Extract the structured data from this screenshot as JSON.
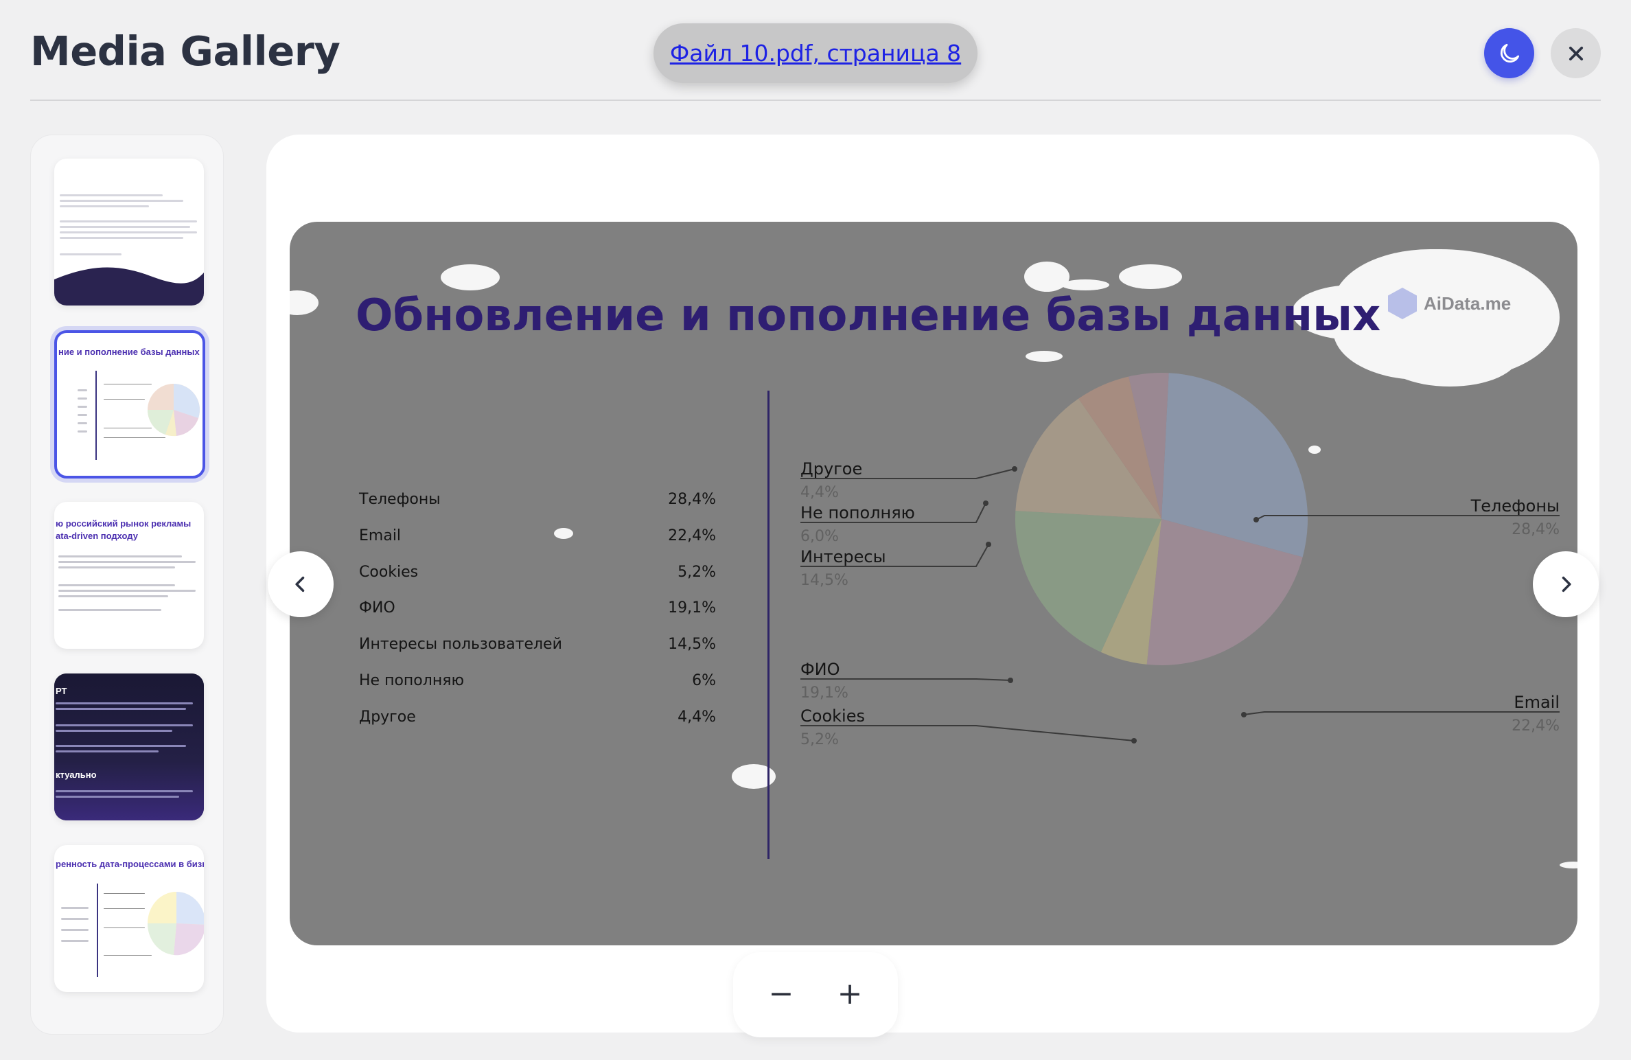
{
  "header": {
    "title": "Media Gallery",
    "source_link": "Файл 10.pdf, страница 8",
    "theme_icon": "moon-icon",
    "close_icon": "close-icon"
  },
  "thumbnails": [
    {
      "heading": "",
      "selected": false
    },
    {
      "heading": "ние и пополнение базы данных",
      "selected": true
    },
    {
      "heading": "ю российский рынок рекламы",
      "heading2": "ata-driven подходу",
      "selected": false
    },
    {
      "heading": "ктуально",
      "selected": false,
      "dark": true
    },
    {
      "heading": "ренность дата-процессами в бизнес",
      "selected": false
    }
  ],
  "slide": {
    "title": "Обновление и пополнение базы данных",
    "brand": "AiData.me",
    "stats": [
      {
        "label": "Телефоны",
        "value": "28,4%"
      },
      {
        "label": "Email",
        "value": "22,4%"
      },
      {
        "label": "Cookies",
        "value": "5,2%"
      },
      {
        "label": "ФИО",
        "value": "19,1%"
      },
      {
        "label": "Интересы пользователей",
        "value": "14,5%"
      },
      {
        "label": "Не пополняю",
        "value": "6%"
      },
      {
        "label": "Другое",
        "value": "4,4%"
      }
    ],
    "pie_labels": {
      "other": {
        "label": "Другое",
        "pct": "4,4%"
      },
      "no_update": {
        "label": "Не пополняю",
        "pct": "6,0%"
      },
      "interests": {
        "label": "Интересы",
        "pct": "14,5%"
      },
      "fio": {
        "label": "ФИО",
        "pct": "19,1%"
      },
      "cookies": {
        "label": "Cookies",
        "pct": "5,2%"
      },
      "phones": {
        "label": "Телефоны",
        "pct": "28,4%"
      },
      "email": {
        "label": "Email",
        "pct": "22,4%"
      }
    },
    "pie_values": [
      28.4,
      22.4,
      5.2,
      19.1,
      14.5,
      6.0,
      4.4
    ],
    "pie_colors": [
      "#8a95a8",
      "#9c8a94",
      "#a8a282",
      "#899a85",
      "#a49888",
      "#a68c80",
      "#9a8892"
    ]
  },
  "nav": {
    "prev_icon": "chevron-left-icon",
    "next_icon": "chevron-right-icon"
  },
  "zoom": {
    "minus": "−",
    "plus": "+"
  }
}
